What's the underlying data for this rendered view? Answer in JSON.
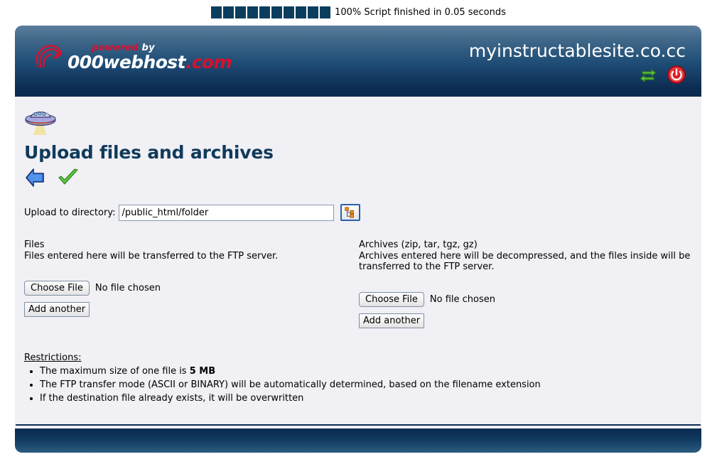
{
  "progress": {
    "blocks": 10,
    "percent_label": "100%",
    "status_text": "Script finished in 0.05 seconds",
    "block_color": "#0b3e5e"
  },
  "header": {
    "logo": {
      "swirl_icon": "swirl-icon",
      "powered": "powered",
      "by": "by",
      "brand_main": "000webhost",
      "brand_tld": ".com",
      "brand_color": "#ffffff",
      "accent_color": "#d8102f"
    },
    "domain": "myinstructablesite.co.cc",
    "icons": [
      {
        "name": "refresh-icon",
        "title": "Refresh",
        "color": "#5cc63c"
      },
      {
        "name": "logout-power-icon",
        "title": "Logout",
        "color": "#e01b22"
      }
    ]
  },
  "main": {
    "page_icon": "ufo-icon",
    "title": "Upload files and archives",
    "toolbar": [
      {
        "name": "back-arrow-icon",
        "title": "Back",
        "color": "#3b7ddd"
      },
      {
        "name": "confirm-check-icon",
        "title": "Confirm",
        "color": "#5cc63c"
      }
    ],
    "directory": {
      "label": "Upload to directory:",
      "value": "/public_html/folder",
      "placeholder": "/public_html/folder",
      "browse_button_name": "directory-browse-button",
      "browse_icon": "directory-tree-icon"
    },
    "files_column": {
      "title": "Files",
      "description": "Files entered here will be transferred to the FTP server.",
      "choose_file_label": "Choose File",
      "no_file_label": "No file chosen",
      "add_another_label": "Add another"
    },
    "archives_column": {
      "title": "Archives (zip, tar, tgz, gz)",
      "description": "Archives entered here will be decompressed, and the files inside will be transferred to the FTP server.",
      "choose_file_label": "Choose File",
      "no_file_label": "No file chosen",
      "add_another_label": "Add another"
    },
    "restrictions": {
      "title": "Restrictions:",
      "items": [
        {
          "text_before": "The maximum size of one file is ",
          "bold": "5 MB",
          "text_after": ""
        },
        {
          "text_before": "The FTP transfer mode (ASCII or BINARY) will be automatically determined, based on the filename extension",
          "bold": "",
          "text_after": ""
        },
        {
          "text_before": "If the destination file already exists, it will be overwritten",
          "bold": "",
          "text_after": ""
        }
      ]
    }
  },
  "colors": {
    "header_top": "#5b7f9c",
    "header_bottom": "#0b2a4f",
    "content_bg": "#f0f0f5",
    "title_navy": "#103a5a"
  }
}
